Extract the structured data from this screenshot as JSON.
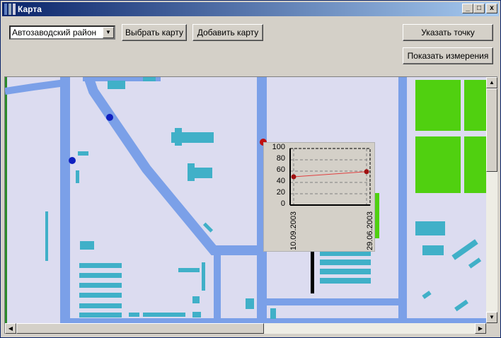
{
  "window": {
    "title": "Карта",
    "minimize": "_",
    "maximize": "□",
    "close": "x"
  },
  "toolbar": {
    "district_select": {
      "value": "Автозаводский район"
    },
    "select_map": "Выбрать карту",
    "add_map": "Добавить карту",
    "point": "Указать точку",
    "show_measurements": "Показать измерения"
  },
  "colors": {
    "map_bg": "#dcdcf0",
    "road": "#7ba0e8",
    "building": "#40b0c8",
    "park": "#50d010",
    "marker_blue": "#1020c0",
    "marker_red": "#c01010"
  },
  "chart_data": {
    "type": "line",
    "categories": [
      "10.09.2003",
      "29.06.2003"
    ],
    "values": [
      50,
      59
    ],
    "ylim": [
      0,
      100
    ],
    "yticks": [
      "0",
      "20",
      "40",
      "60",
      "80",
      "100"
    ],
    "grid": true
  }
}
